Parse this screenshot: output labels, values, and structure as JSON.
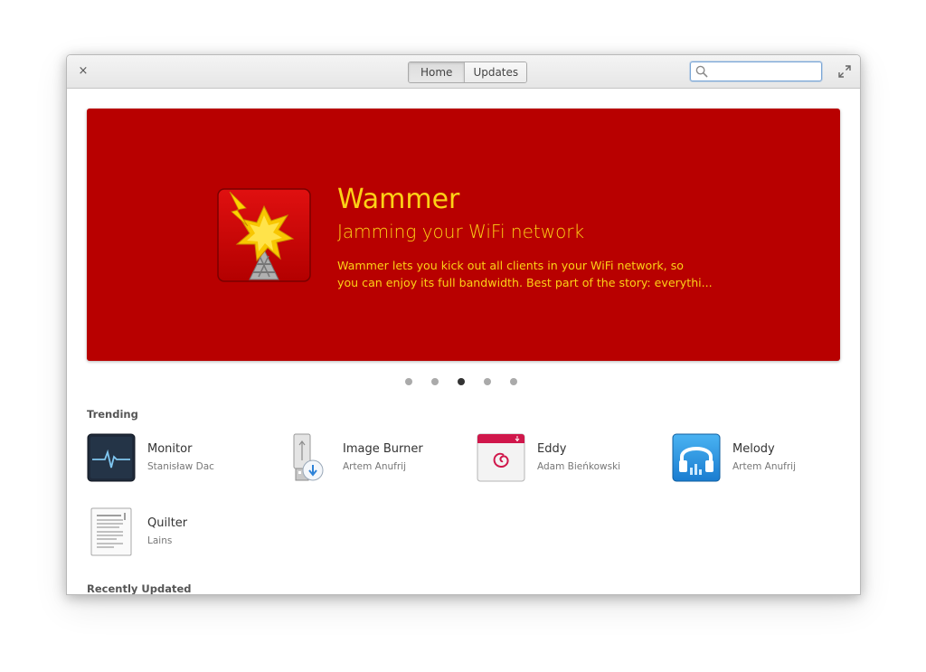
{
  "titlebar": {
    "close_glyph": "×",
    "tabs": [
      {
        "label": "Home",
        "active": true
      },
      {
        "label": "Updates",
        "active": false
      }
    ],
    "search": {
      "value": "",
      "placeholder": "",
      "icon": "search-icon"
    },
    "maximize_icon": "maximize-icon"
  },
  "banner": {
    "title": "Wammer",
    "subtitle": "Jamming your WiFi network",
    "description_lines": [
      "Wammer lets you kick out all clients in your WiFi network, so",
      "you can enjoy its full bandwidth. Best part of the story: everythi..."
    ],
    "background_color": "#b80000",
    "text_color": "#fcd116",
    "icon": "wammer-app-icon"
  },
  "carousel": {
    "count": 5,
    "active_index": 2
  },
  "trending": {
    "title": "Trending",
    "apps": [
      {
        "name": "Monitor",
        "author": "Stanisław Dac",
        "icon": "monitor-app-icon"
      },
      {
        "name": "Image Burner",
        "author": "Artem Anufrij",
        "icon": "image-burner-app-icon"
      },
      {
        "name": "Eddy",
        "author": "Adam Bieńkowski",
        "icon": "eddy-app-icon"
      },
      {
        "name": "Melody",
        "author": "Artem Anufrij",
        "icon": "melody-app-icon"
      },
      {
        "name": "Quilter",
        "author": "Lains",
        "icon": "quilter-app-icon"
      }
    ]
  },
  "recently_updated": {
    "title": "Recently Updated"
  }
}
